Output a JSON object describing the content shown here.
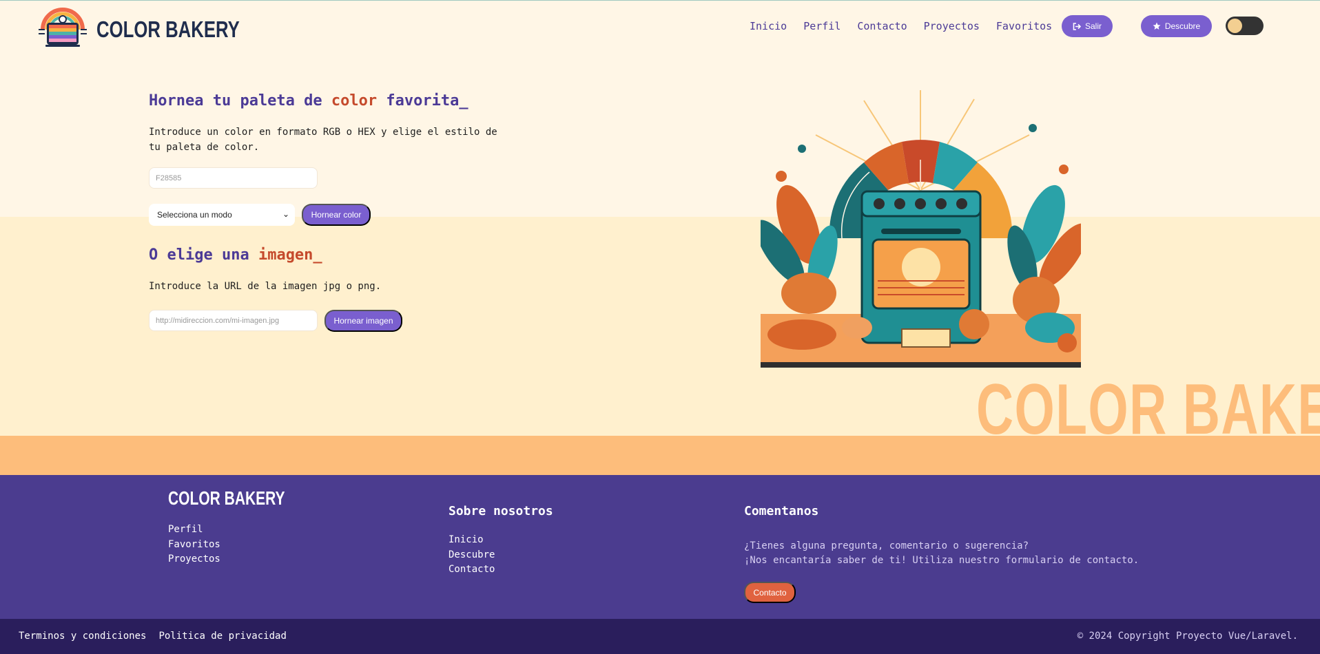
{
  "header": {
    "logo_text": "COLOR BAKERY",
    "nav": [
      "Inicio",
      "Perfil",
      "Contacto",
      "Proyectos",
      "Favoritos"
    ],
    "salir_label": "Salir",
    "descubre_label": "Descubre",
    "theme_toggle": "dark-mode-toggle"
  },
  "hero": {
    "title1_pre": "Hornea tu paleta de ",
    "title1_accent": "color",
    "title1_post": " favorita_",
    "para1": "Introduce un color en formato RGB o HEX y elige el estilo de tu paleta de color.",
    "hex_placeholder": "F28585",
    "select_value": "Selecciona un modo",
    "btn_color": "Hornear color",
    "title2_pre": "O elige una ",
    "title2_accent": "imagen_",
    "para2": "Introduce la URL de la imagen jpg o png.",
    "url_placeholder": "http://midireccion.com/mi-imagen.jpg",
    "btn_image": "Hornear imagen",
    "watermark": "COLOR BAKERY"
  },
  "footer": {
    "logo_text": "COLOR BAKERY",
    "col1": [
      "Perfil",
      "Favoritos",
      "Proyectos"
    ],
    "col2_title": "Sobre nosotros",
    "col2": [
      "Inicio",
      "Descubre",
      "Contacto"
    ],
    "col3_title": "Comentanos",
    "col3_line1": "¿Tienes alguna pregunta, comentario o sugerencia?",
    "col3_line2": "¡Nos encantaría saber de ti! Utiliza nuestro formulario de contacto.",
    "contact_btn": "Contacto"
  },
  "bottom": {
    "terms": "Terminos y condiciones",
    "privacy": "Politica de privacidad",
    "copyright": "© 2024 Copyright Proyecto Vue/Laravel."
  },
  "colors": {
    "primary": "#7a5fcf",
    "accent": "#c54a2c",
    "footer": "#4b3c8f",
    "footer_bottom": "#2a1e5c",
    "orange": "#fdbd7b",
    "cream": "#fff0ce"
  }
}
